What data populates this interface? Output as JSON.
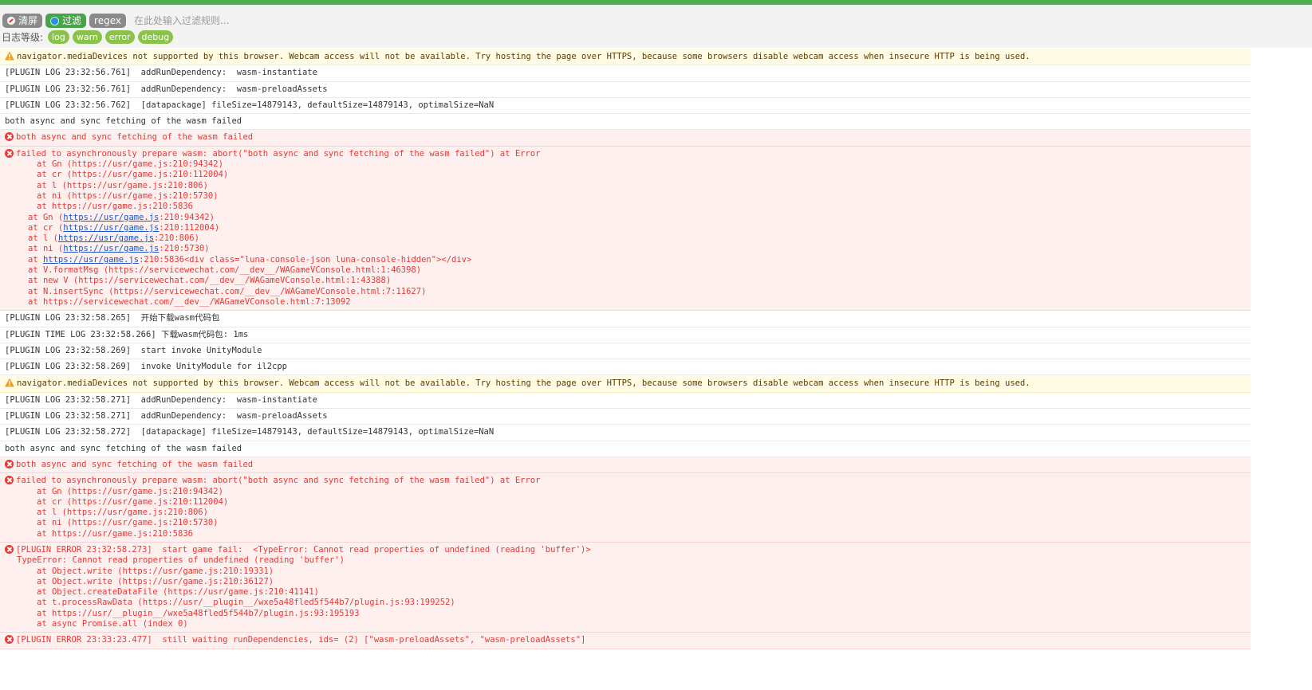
{
  "toolbar": {
    "clear_label": "清屏",
    "filter_label": "过滤",
    "regex_label": "regex",
    "filter_placeholder": "在此处输入过滤规则...",
    "level_label": "日志等级:",
    "levels": [
      "log",
      "warn",
      "error",
      "debug"
    ]
  },
  "colors": {
    "accent": "#4caf50",
    "error": "#e53935",
    "warn_bg": "#fffbe5",
    "error_bg": "#fff0f0",
    "level_pill": "#8bc34a"
  },
  "icons": {
    "clear": "no-entry-icon",
    "filter": "filter-icon",
    "warn": "warning-triangle-icon",
    "error": "error-circle-icon"
  },
  "entries": [
    {
      "type": "warn",
      "text": "navigator.mediaDevices not supported by this browser. Webcam access will not be available. Try hosting the page over HTTPS, because some browsers disable webcam access when insecure HTTP is being used."
    },
    {
      "type": "log",
      "text": "[PLUGIN LOG 23:32:56.761]  addRunDependency:  wasm-instantiate"
    },
    {
      "type": "log",
      "text": "[PLUGIN LOG 23:32:56.761]  addRunDependency:  wasm-preloadAssets"
    },
    {
      "type": "log",
      "text": "[PLUGIN LOG 23:32:56.762]  [datapackage] fileSize=14879143, defaultSize=14879143, optimalSize=NaN"
    },
    {
      "type": "log",
      "text": "both async and sync fetching of the wasm failed"
    },
    {
      "type": "error",
      "text": "both async and sync fetching of the wasm failed"
    },
    {
      "type": "error",
      "text": "failed to asynchronously prepare wasm: abort(\"both async and sync fetching of the wasm failed\") at Error",
      "stack": [
        {
          "ind": 1,
          "text": "at Gn (https://usr/game.js:210:94342)"
        },
        {
          "ind": 1,
          "text": "at cr (https://usr/game.js:210:112004)"
        },
        {
          "ind": 1,
          "text": "at l (https://usr/game.js:210:806)"
        },
        {
          "ind": 1,
          "text": "at ni (https://usr/game.js:210:5730)"
        },
        {
          "ind": 1,
          "text": "at https://usr/game.js:210:5836"
        },
        {
          "ind": 2,
          "pre": "at Gn (",
          "link": "https://usr/game.js",
          "post": ":210:94342)"
        },
        {
          "ind": 2,
          "pre": "at cr (",
          "link": "https://usr/game.js",
          "post": ":210:112004)"
        },
        {
          "ind": 2,
          "pre": "at l (",
          "link": "https://usr/game.js",
          "post": ":210:806)"
        },
        {
          "ind": 2,
          "pre": "at ni (",
          "link": "https://usr/game.js",
          "post": ":210:5730)"
        },
        {
          "ind": 2,
          "pre": "at ",
          "link": "https://usr/game.js",
          "post": ":210:5836<div class=\"luna-console-json luna-console-hidden\"></div>"
        },
        {
          "ind": 2,
          "text": "at V.formatMsg (https://servicewechat.com/__dev__/WAGameVConsole.html:1:46398)"
        },
        {
          "ind": 2,
          "text": "at new V (https://servicewechat.com/__dev__/WAGameVConsole.html:1:43388)"
        },
        {
          "ind": 2,
          "text": "at N.insertSync (https://servicewechat.com/__dev__/WAGameVConsole.html:7:11627)"
        },
        {
          "ind": 2,
          "text": "at https://servicewechat.com/__dev__/WAGameVConsole.html:7:13092"
        }
      ]
    },
    {
      "type": "log",
      "text": "[PLUGIN LOG 23:32:58.265]  开始下载wasm代码包"
    },
    {
      "type": "log",
      "text": "[PLUGIN TIME LOG 23:32:58.266] 下载wasm代码包: 1ms"
    },
    {
      "type": "log",
      "text": "[PLUGIN LOG 23:32:58.269]  start invoke UnityModule"
    },
    {
      "type": "log",
      "text": "[PLUGIN LOG 23:32:58.269]  invoke UnityModule for il2cpp"
    },
    {
      "type": "warn",
      "text": "navigator.mediaDevices not supported by this browser. Webcam access will not be available. Try hosting the page over HTTPS, because some browsers disable webcam access when insecure HTTP is being used."
    },
    {
      "type": "log",
      "text": "[PLUGIN LOG 23:32:58.271]  addRunDependency:  wasm-instantiate"
    },
    {
      "type": "log",
      "text": "[PLUGIN LOG 23:32:58.271]  addRunDependency:  wasm-preloadAssets"
    },
    {
      "type": "log",
      "text": "[PLUGIN LOG 23:32:58.272]  [datapackage] fileSize=14879143, defaultSize=14879143, optimalSize=NaN"
    },
    {
      "type": "log",
      "text": "both async and sync fetching of the wasm failed"
    },
    {
      "type": "error",
      "text": "both async and sync fetching of the wasm failed"
    },
    {
      "type": "error",
      "text": "failed to asynchronously prepare wasm: abort(\"both async and sync fetching of the wasm failed\") at Error",
      "stack": [
        {
          "ind": 1,
          "text": "at Gn (https://usr/game.js:210:94342)"
        },
        {
          "ind": 1,
          "text": "at cr (https://usr/game.js:210:112004)"
        },
        {
          "ind": 1,
          "text": "at l (https://usr/game.js:210:806)"
        },
        {
          "ind": 1,
          "text": "at ni (https://usr/game.js:210:5730)"
        },
        {
          "ind": 1,
          "text": "at https://usr/game.js:210:5836"
        }
      ]
    },
    {
      "type": "error",
      "text": "[PLUGIN ERROR 23:32:58.273]  start game fail:  <TypeError: Cannot read properties of undefined (reading 'buffer')>",
      "stack": [
        {
          "ind": 0,
          "text": "TypeError: Cannot read properties of undefined (reading 'buffer')"
        },
        {
          "ind": 1,
          "text": "at Object.write (https://usr/game.js:210:19331)"
        },
        {
          "ind": 1,
          "text": "at Object.write (https://usr/game.js:210:36127)"
        },
        {
          "ind": 1,
          "text": "at Object.createDataFile (https://usr/game.js:210:41141)"
        },
        {
          "ind": 1,
          "text": "at t.processRawData (https://usr/__plugin__/wxe5a48fled5f544b7/plugin.js:93:199252)"
        },
        {
          "ind": 1,
          "text": "at https://usr/__plugin__/wxe5a48fled5f544b7/plugin.js:93:195193"
        },
        {
          "ind": 1,
          "text": "at async Promise.all (index 0)"
        }
      ]
    },
    {
      "type": "error",
      "text": "[PLUGIN ERROR 23:33:23.477]  still waiting runDependencies, ids= (2) [\"wasm-preloadAssets\", \"wasm-preloadAssets\"]"
    }
  ]
}
